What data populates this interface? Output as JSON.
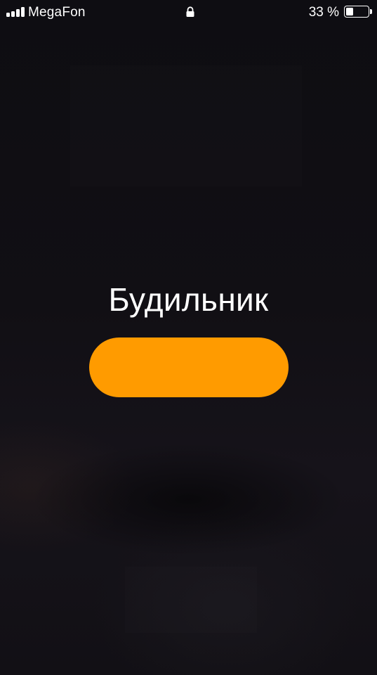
{
  "status_bar": {
    "carrier": "MegaFon",
    "signal_bars": 4,
    "lock_icon": "lock-icon",
    "battery_percent_label": "33 %",
    "battery_level": 0.33
  },
  "alarm": {
    "title": "Будильник",
    "button_label": "",
    "button_color": "#ff9b00"
  }
}
